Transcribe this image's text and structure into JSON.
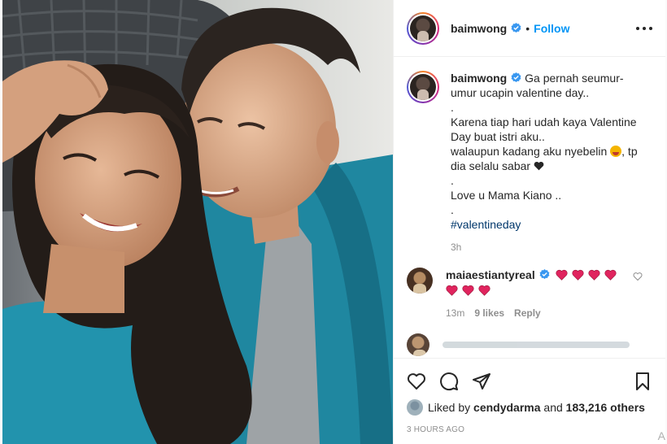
{
  "post": {
    "username": "baimwong",
    "follow_label": "Follow",
    "separator": "•",
    "caption_lines": [
      "Ga pernah seumur-",
      "umur ucapin valentine day..",
      ".",
      "Karena tiap hari udah kaya Valentine",
      "Day buat istri aku..",
      "walaupun kadang aku nyebelin",
      ", tp",
      "dia selalu sabar",
      ".",
      "Love u Mama Kiano ..",
      "."
    ],
    "hashtag": "#valentineday",
    "caption_time": "3h"
  },
  "comment": {
    "username": "maiaestiantyreal",
    "time": "13m",
    "likes": "9 likes",
    "reply_label": "Reply"
  },
  "likes": {
    "prefix": "Liked by",
    "user": "cendydarma",
    "middle": "and",
    "count": "183,216 others"
  },
  "timestamp": "3 HOURS AGO",
  "corner_mark": "A",
  "colors": {
    "accent": "#0095f6",
    "hashtag": "#00376b",
    "heart": "#ed4956",
    "teal_blanket": "#1e8ea6"
  },
  "icons": [
    "verified-badge-icon",
    "more-options-icon",
    "heart-outline-icon",
    "comment-icon",
    "share-icon",
    "bookmark-icon",
    "red-heart-icon",
    "black-heart-icon",
    "face-emoji-icon"
  ]
}
